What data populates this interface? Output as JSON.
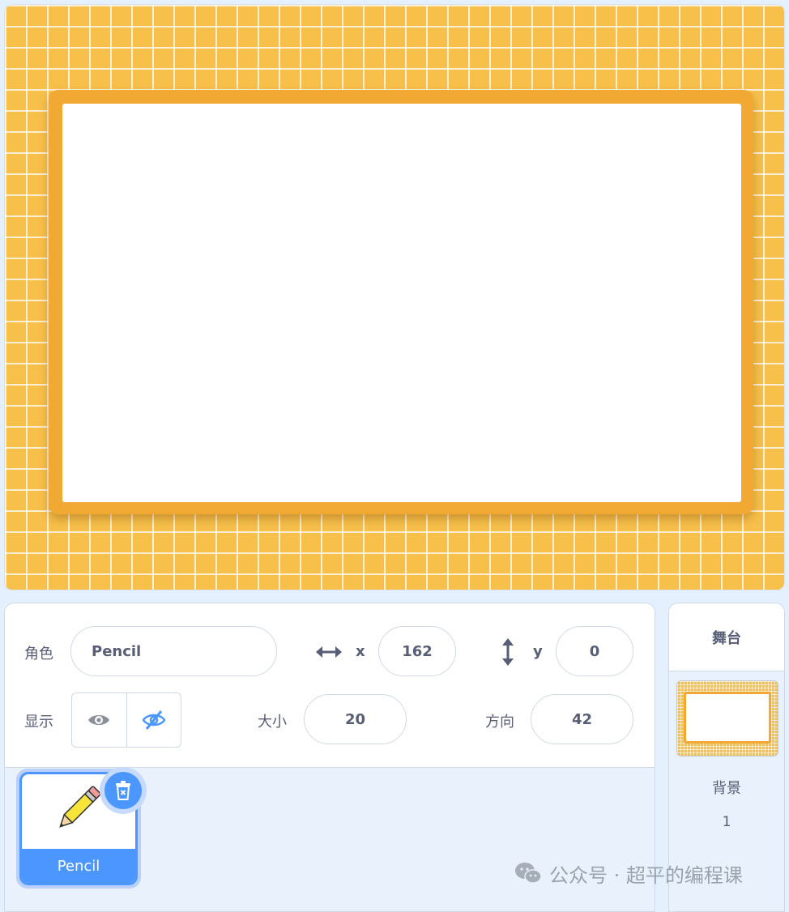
{
  "sprite_info": {
    "sprite_label": "角色",
    "sprite_name": "Pencil",
    "x_label": "x",
    "x_value": "162",
    "y_label": "y",
    "y_value": "0",
    "show_label": "显示",
    "size_label": "大小",
    "size_value": "20",
    "direction_label": "方向",
    "direction_value": "42"
  },
  "sprites": [
    {
      "name": "Pencil",
      "icon": "pencil-costume"
    }
  ],
  "stage_panel": {
    "title": "舞台",
    "backdrop_label": "背景",
    "backdrop_count": "1"
  },
  "watermark": "公众号 · 超平的编程课",
  "colors": {
    "accent": "#4c97ff",
    "stage_bg": "#f7c04a",
    "frame": "#f2a934",
    "text": "#575e75"
  }
}
